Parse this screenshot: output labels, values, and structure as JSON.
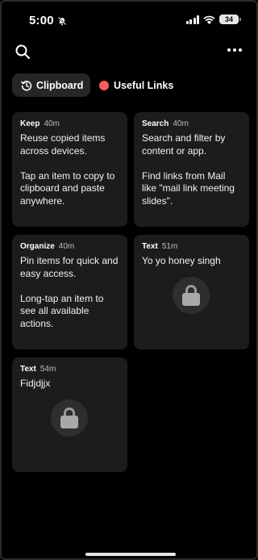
{
  "status_bar": {
    "time": "5:00",
    "battery": "34"
  },
  "tabs": [
    {
      "label": "Clipboard",
      "icon": "history-icon",
      "selected": true
    },
    {
      "label": "Useful Links",
      "icon": "red-dot",
      "color": "#ff5a5f",
      "selected": false
    }
  ],
  "cards": [
    {
      "title": "Keep",
      "time": "40m",
      "body": "Reuse copied items across devices.\n\nTap an item to copy to clipboard and paste anywhere.",
      "locked": false
    },
    {
      "title": "Search",
      "time": "40m",
      "body": "Search and filter by content or app.\n\nFind links from Mail like \"mail link meeting slides\".",
      "locked": false
    },
    {
      "title": "Organize",
      "time": "40m",
      "body": "Pin items for quick and easy access.\n\nLong-tap an item to see all available actions.",
      "locked": false
    },
    {
      "title": "Text",
      "time": "51m",
      "body": "Yo yo honey singh",
      "locked": true
    },
    {
      "title": "Text",
      "time": "54m",
      "body": "Fidjdjjx",
      "locked": true
    }
  ],
  "colors": {
    "background": "#000000",
    "card": "#1c1c1e",
    "accent": "#ff5a5f"
  }
}
